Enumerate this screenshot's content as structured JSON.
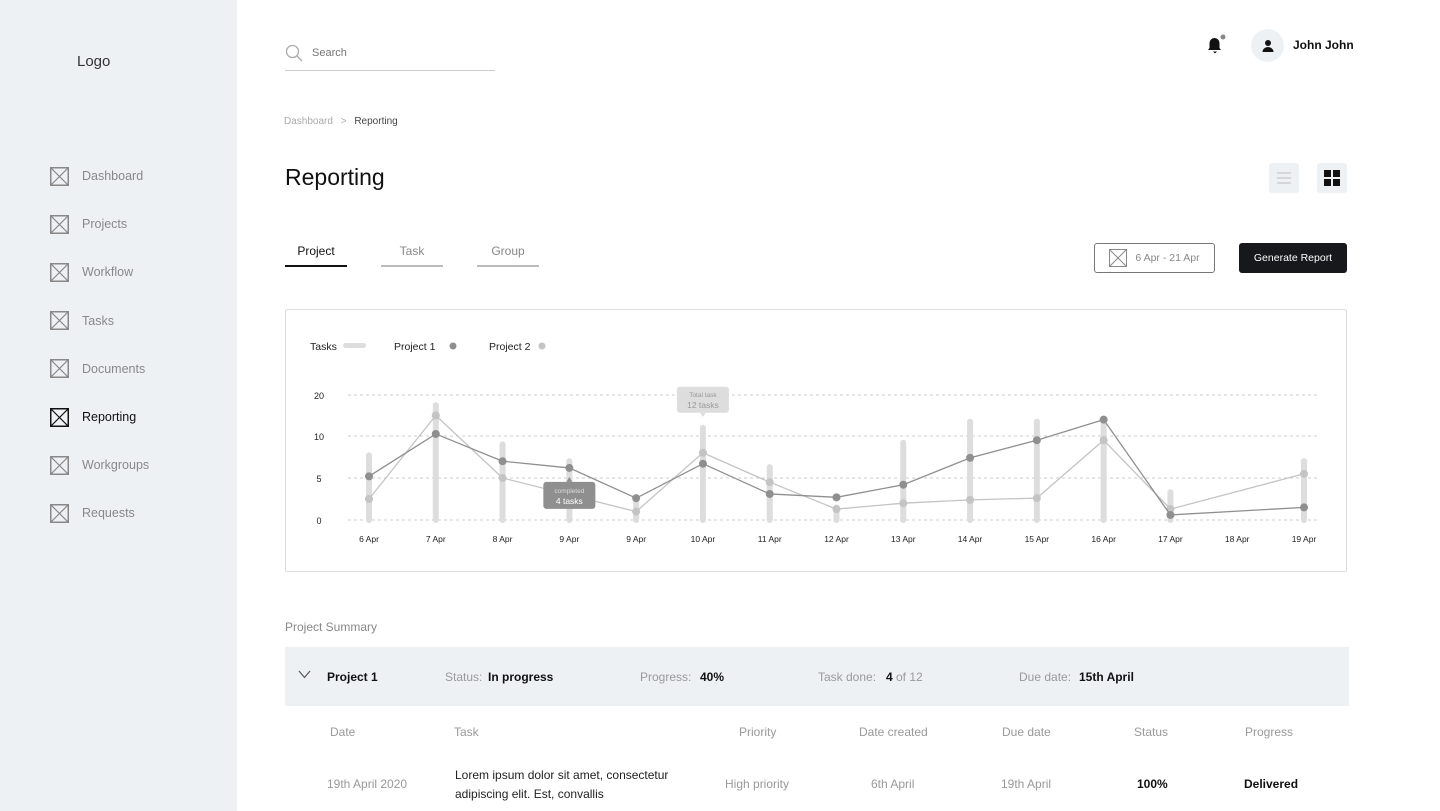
{
  "sidebar": {
    "logo": "Logo",
    "items": [
      {
        "label": "Dashboard"
      },
      {
        "label": "Projects"
      },
      {
        "label": "Workflow"
      },
      {
        "label": "Tasks"
      },
      {
        "label": "Documents"
      },
      {
        "label": "Reporting",
        "active": true
      },
      {
        "label": "Workgroups"
      },
      {
        "label": "Requests"
      }
    ]
  },
  "header": {
    "search_placeholder": "Search",
    "user_name": "John John",
    "notification_dot": true
  },
  "breadcrumb": {
    "parent": "Dashboard",
    "separator": ">",
    "current": "Reporting"
  },
  "page": {
    "title": "Reporting"
  },
  "tabs": [
    {
      "label": "Project",
      "active": true
    },
    {
      "label": "Task"
    },
    {
      "label": "Group"
    }
  ],
  "toolbar": {
    "date_range": "6 Apr - 21 Apr",
    "generate_label": "Generate Report"
  },
  "chart_data": {
    "type": "bar+line",
    "legend": [
      {
        "name": "Tasks",
        "color": "#dddddd"
      },
      {
        "name": "Project 1",
        "color": "#8f8f8f"
      },
      {
        "name": "Project 2",
        "color": "#c4c4c4"
      }
    ],
    "legend_position": "top-left",
    "categories": [
      "6 Apr",
      "7 Apr",
      "8 Apr",
      "9 Apr",
      "9 Apr",
      "10 Apr",
      "11 Apr",
      "12 Apr",
      "13 Apr",
      "14 Apr",
      "15 Apr",
      "16 Apr",
      "17 Apr",
      "18 Apr",
      "19 Apr"
    ],
    "y_ticks": [
      0,
      5,
      10,
      20
    ],
    "grid": true,
    "series": [
      {
        "name": "Tasks",
        "kind": "bar",
        "values": [
          7.7,
          17.5,
          9,
          7,
          2,
          12,
          6.3,
          1.5,
          9.2,
          13.5,
          13.5,
          13.5,
          3.3,
          0,
          7
        ]
      },
      {
        "name": "Project 1",
        "kind": "line",
        "values": [
          5.2,
          10.5,
          7,
          6.2,
          2.6,
          6.7,
          3.1,
          2.7,
          4.2,
          7.4,
          9.5,
          14,
          0.6,
          null,
          1.5
        ]
      },
      {
        "name": "Project 2",
        "kind": "line",
        "values": [
          2.5,
          15,
          5,
          3,
          1,
          8,
          4.5,
          1.3,
          2,
          2.4,
          2.6,
          9.5,
          1.3,
          null,
          5.5
        ]
      }
    ],
    "annotations": [
      {
        "category_index": 5,
        "title": "Total task",
        "value": "12 tasks"
      },
      {
        "category_index": 3,
        "title": "completed",
        "value": "4 tasks"
      }
    ]
  },
  "summary": {
    "label": "Project Summary",
    "project": {
      "name": "Project 1",
      "status_label": "Status:",
      "status": "In progress",
      "progress_label": "Progress:",
      "progress": "40%",
      "tasks_label": "Task done:",
      "tasks_done": "4",
      "tasks_of": "of 12",
      "due_label": "Due date:",
      "due": "15th April"
    },
    "columns": [
      "Date",
      "Task",
      "Priority",
      "Date created",
      "Due date",
      "Status",
      "Progress"
    ],
    "rows": [
      {
        "date": "19th April 2020",
        "task": "Lorem ipsum dolor sit amet, consectetur adipiscing elit. Est, convallis",
        "priority": "High priority",
        "created": "6th April",
        "due": "19th April",
        "status": "100%",
        "progress": "Delivered"
      }
    ]
  }
}
